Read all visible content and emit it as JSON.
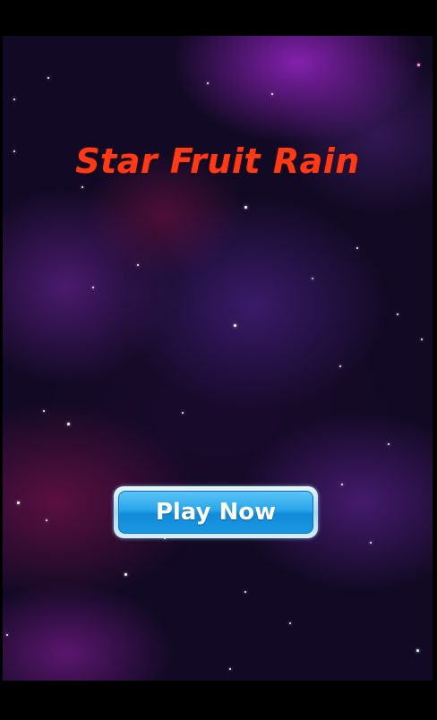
{
  "game": {
    "title": "Star Fruit Rain",
    "play_button_label": "Play Now"
  },
  "colors": {
    "title": "#ff3a14",
    "button": "#28a6ea",
    "background": "#120a24"
  },
  "icons": {
    "stars": "star-icon"
  }
}
